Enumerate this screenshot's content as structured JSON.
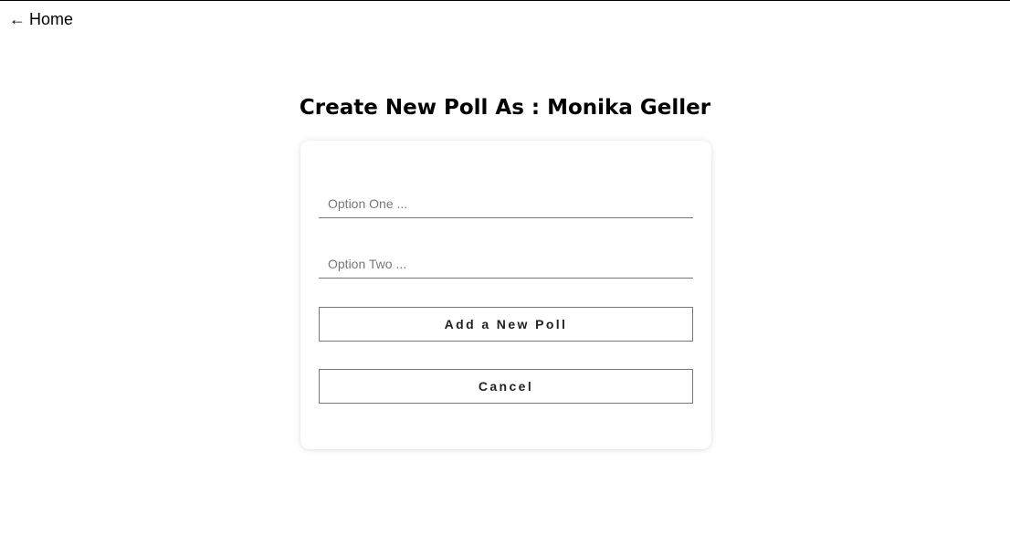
{
  "nav": {
    "home_arrow": "←",
    "home_label": "Home"
  },
  "page": {
    "title": "Create New Poll As : Monika Geller"
  },
  "form": {
    "option_one": {
      "value": "",
      "placeholder": "Option One ..."
    },
    "option_two": {
      "value": "",
      "placeholder": "Option Two ..."
    },
    "add_label": "Add a New Poll",
    "cancel_label": "Cancel"
  },
  "colors": {
    "background": "#ffffff",
    "border": "#777777",
    "text": "#000000"
  }
}
